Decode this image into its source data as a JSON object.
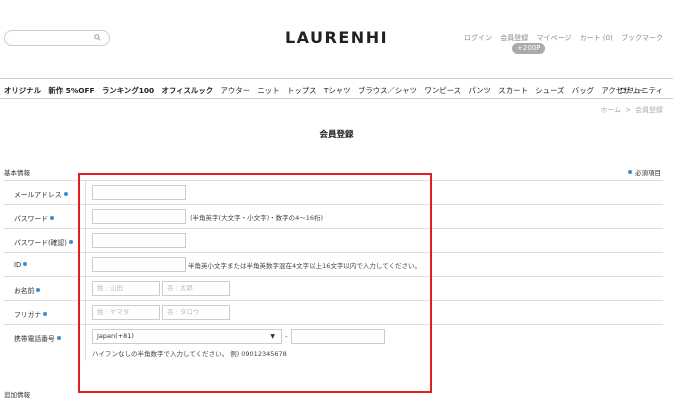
{
  "header": {
    "logo": "LAURENHI",
    "search": {
      "placeholder": ""
    },
    "usernav": [
      "ログイン",
      "会員登録",
      "マイページ",
      "カート (0)",
      "ブックマーク"
    ],
    "points_badge": "+200P"
  },
  "gnav": {
    "items": [
      {
        "label": "オリジナル",
        "bold": true
      },
      {
        "label": "新作 5%OFF",
        "bold": true
      },
      {
        "label": "ランキング100",
        "bold": true
      },
      {
        "label": "オフィスルック",
        "bold": true
      },
      {
        "label": "アウター",
        "bold": false
      },
      {
        "label": "ニット",
        "bold": false
      },
      {
        "label": "トップス",
        "bold": false
      },
      {
        "label": "Tシャツ",
        "bold": false
      },
      {
        "label": "ブラウス／シャツ",
        "bold": false
      },
      {
        "label": "ワンピース",
        "bold": false
      },
      {
        "label": "パンツ",
        "bold": false
      },
      {
        "label": "スカート",
        "bold": false
      },
      {
        "label": "シューズ",
        "bold": false
      },
      {
        "label": "バッグ",
        "bold": false
      },
      {
        "label": "アクセサリー",
        "bold": false
      }
    ],
    "community": "コミュニティ"
  },
  "breadcrumb": {
    "home": "ホーム",
    "separator": ">",
    "current": "会員登録"
  },
  "page_title": "会員登録",
  "sections": {
    "basic": "基本情報",
    "additional": "追加情報"
  },
  "required_note": "必須項目",
  "accent_color": "#3b8fd3",
  "highlight_color": "#e02020",
  "form": {
    "email": {
      "label": "メールアドレス"
    },
    "password": {
      "label": "パスワード",
      "note": "(半角英字(大文字・小文字)・数字の4～16桁)"
    },
    "password_confirm": {
      "label": "パスワード(確認)"
    },
    "id": {
      "label": "ID",
      "note": "半角英小文字または半角英数字混在4文字以上16文字以内で入力してください。"
    },
    "name": {
      "label": "お名前",
      "last_placeholder": "姓 : 山田",
      "first_placeholder": "名 : 太郎"
    },
    "furigana": {
      "label": "フリガナ",
      "last_placeholder": "姓 : ヤマダ",
      "first_placeholder": "名 : タロウ"
    },
    "phone": {
      "label": "携帯電話番号",
      "country": "Japan(+81)",
      "dash": "-",
      "hint": "ハイフンなしの半角数字で入力してください。 例) 09012345678"
    }
  }
}
